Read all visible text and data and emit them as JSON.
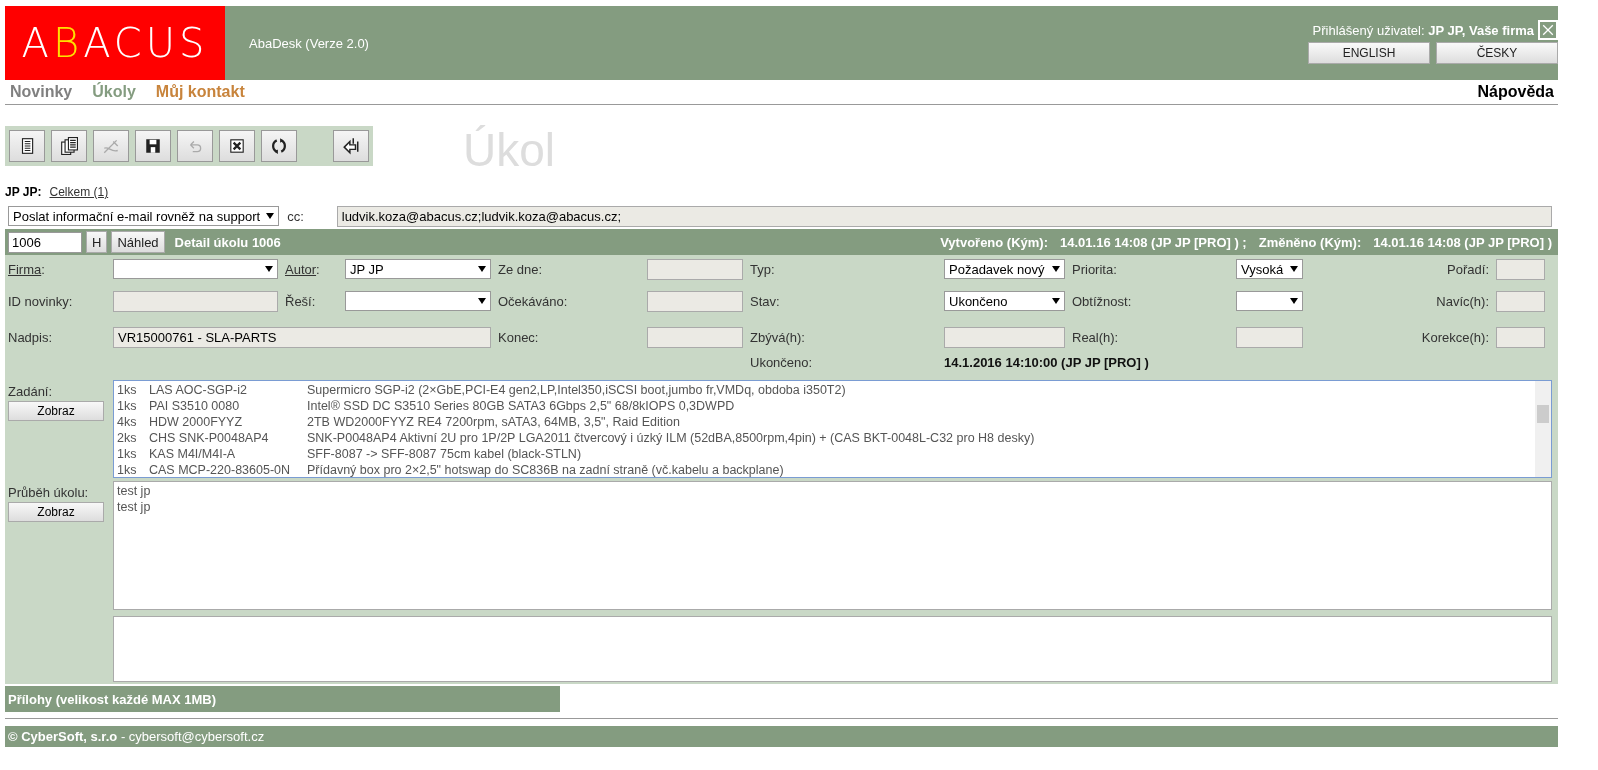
{
  "header": {
    "logo": [
      {
        "text": "A",
        "accent": false
      },
      {
        "text": "B",
        "accent": true
      },
      {
        "text": "ACUS",
        "accent": false
      }
    ],
    "app_title": "AbaDesk (Verze 2.0)",
    "user": "Přihlášený uživatel: **JP JP, Vaše firma**",
    "languages": [
      "ENGLISH",
      "ČESKY"
    ]
  },
  "nav": {
    "items": [
      {
        "label": "Novinky",
        "color": "#808080"
      },
      {
        "label": "Úkoly",
        "color": "#849c80"
      },
      {
        "label": "Můj kontakt",
        "color": "#c8843c"
      }
    ],
    "help": "Nápověda"
  },
  "toolbar": [
    {
      "kind": "document",
      "disabled": false
    },
    {
      "kind": "documents",
      "disabled": false
    },
    {
      "kind": "edit",
      "disabled": true
    },
    {
      "kind": "save",
      "disabled": false
    },
    {
      "kind": "undo",
      "disabled": true
    },
    {
      "kind": "cancel",
      "disabled": false
    },
    {
      "kind": "refresh",
      "disabled": false
    },
    {
      "kind": "exit",
      "disabled": false
    }
  ],
  "page_title": "Úkol",
  "owner": {
    "name": "JP JP:",
    "link": "Celkem (1)"
  },
  "email": {
    "option": "Poslat informační e-mail rovněž na support",
    "cc_label": "cc:",
    "cc": "ludvik.koza@abacus.cz;ludvik.koza@abacus.cz;"
  },
  "detail_bar": {
    "number": "1006",
    "buttons": [
      "H",
      "Náhled"
    ],
    "title": "Detail úkolu 1006",
    "created_label": "Vytvořeno (Kým):",
    "created": "14.01.16 14:08 (JP JP [PRO] ) ;",
    "changed_label": "Změněno (Kým):",
    "changed": "14.01.16 14:08 (JP JP [PRO] )"
  },
  "form_rows": [
    [
      {
        "kind": "link",
        "text": "Firma",
        "suffix": ":"
      },
      {
        "kind": "select"
      },
      {
        "kind": "link",
        "text": "Autor",
        "suffix": ":"
      },
      {
        "kind": "select",
        "value": "JP JP"
      },
      {
        "kind": "label",
        "text": "Ze dne:"
      },
      {
        "kind": "input"
      },
      {
        "kind": "label",
        "text": "Typ:"
      },
      {
        "kind": "select",
        "value": "Požadavek nový"
      },
      {
        "kind": "label",
        "text": "Priorita:"
      },
      {
        "kind": "select",
        "value": "Vysoká"
      },
      {
        "kind": "label",
        "text": "Pořadí:"
      },
      {
        "kind": "input"
      }
    ],
    [
      {
        "kind": "label",
        "text": "ID novinky:"
      },
      {
        "kind": "input"
      },
      {
        "kind": "label",
        "text": "Řeší:"
      },
      {
        "kind": "select"
      },
      {
        "kind": "label",
        "text": "Očekáváno:"
      },
      {
        "kind": "input"
      },
      {
        "kind": "label",
        "text": "Stav:"
      },
      {
        "kind": "select",
        "value": "Ukončeno"
      },
      {
        "kind": "label",
        "text": "Obtížnost:"
      },
      {
        "kind": "select"
      },
      {
        "kind": "label",
        "text": "Navíc(h):"
      },
      {
        "kind": "input"
      }
    ],
    [
      {
        "kind": "label",
        "text": "Nadpis:"
      },
      {
        "kind": "input",
        "value": "VR15000761 - SLA-PARTS"
      },
      {
        "kind": "label",
        "text": "Konec:"
      },
      {
        "kind": "input"
      },
      {
        "kind": "label",
        "text": "Zbývá(h):"
      },
      {
        "kind": "input"
      },
      {
        "kind": "label",
        "text": "Real(h):"
      },
      {
        "kind": "input"
      },
      {
        "kind": "label",
        "text": "Korekce(h):"
      },
      {
        "kind": "input"
      }
    ],
    [
      {
        "kind": "label",
        "text": "Ukončeno:"
      },
      {
        "kind": "value",
        "text": "14.1.2016 14:10:00 (JP JP [PRO] )"
      }
    ]
  ],
  "assignment": {
    "label": "Zadání:",
    "button": "Zobraz",
    "lines": [
      {
        "qty": "1ks",
        "code": "LAS AOC-SGP-i2",
        "description": "Supermicro SGP-i2 (2×GbE,PCI-E4 gen2,LP,Intel350,iSCSI boot,jumbo fr,VMDq, obdoba i350T2)"
      },
      {
        "qty": "1ks",
        "code": "PAI S3510 0080",
        "description": "Intel® SSD DC S3510 Series 80GB SATA3 6Gbps 2,5\" 68/8kIOPS 0,3DWPD"
      },
      {
        "qty": "4ks",
        "code": "HDW 2000FYYZ",
        "description": "2TB WD2000FYYZ RE4 7200rpm, sATA3, 64MB, 3,5\", Raid Edition"
      },
      {
        "qty": "2ks",
        "code": "CHS SNK-P0048AP4",
        "description": "SNK-P0048AP4 Aktivní 2U pro 1P/2P LGA2011 čtvercový i úzký ILM (52dBA,8500rpm,4pin) + (CAS BKT-0048L-C32 pro H8 desky)"
      },
      {
        "qty": "1ks",
        "code": "KAS M4I/M4I-A",
        "description": "SFF-8087 -> SFF-8087 75cm kabel (black-STLN)"
      },
      {
        "qty": "1ks",
        "code": "CAS MCP-220-83605-0N",
        "description": "Přídavný box pro 2×2,5\" hotswap do SC836B na zadní straně (vč.kabelu a backplane)"
      }
    ]
  },
  "progress": {
    "label": "Průběh úkolu:",
    "button": "Zobraz",
    "lines": [
      "test jp",
      "test jp"
    ]
  },
  "attachments": "Přílohy (velikost každé MAX 1MB)",
  "footer": "**© CyberSoft, s.r.o** - cybersoft@cybersoft.cz"
}
